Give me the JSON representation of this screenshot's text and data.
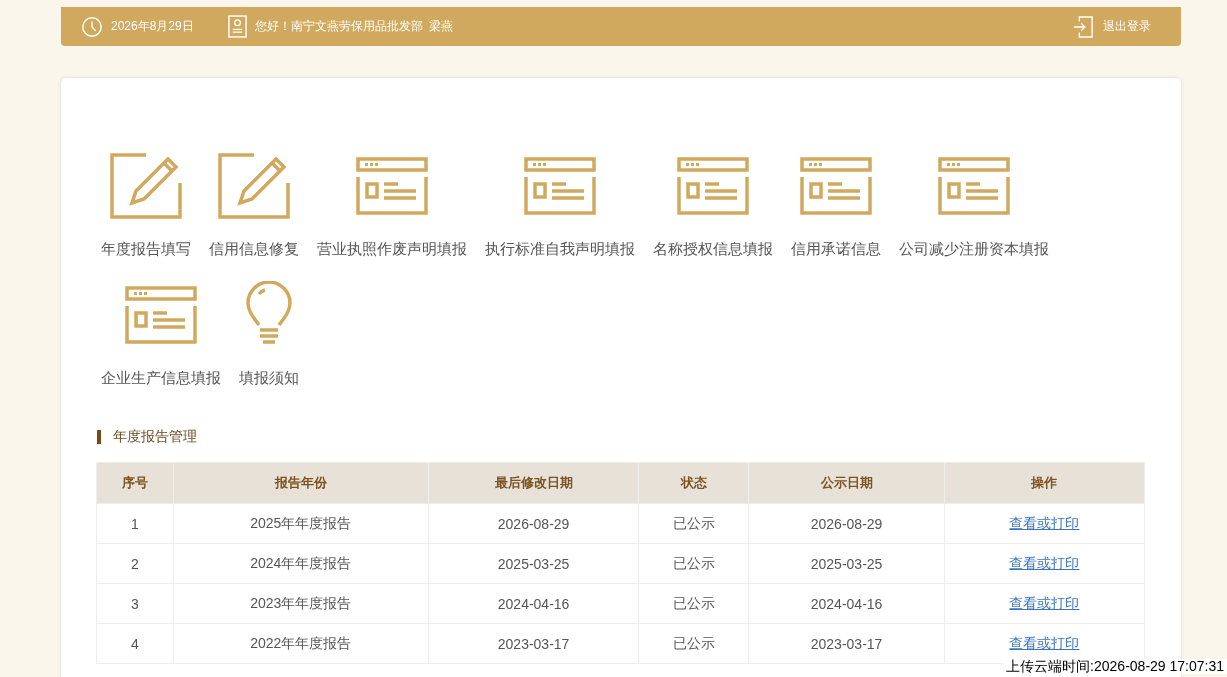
{
  "header": {
    "date": "2026年8月29日",
    "greeting": "您好！南宁文燕劳保用品批发部  梁燕",
    "logout": "退出登录"
  },
  "shortcuts": [
    {
      "kind": "edit",
      "label": "年度报告填写"
    },
    {
      "kind": "edit",
      "label": "信用信息修复"
    },
    {
      "kind": "form",
      "label": "营业执照作废声明填报"
    },
    {
      "kind": "form",
      "label": "执行标准自我声明填报"
    },
    {
      "kind": "form",
      "label": "名称授权信息填报"
    },
    {
      "kind": "form",
      "label": "信用承诺信息"
    },
    {
      "kind": "form",
      "label": "公司减少注册资本填报"
    },
    {
      "kind": "form",
      "label": "企业生产信息填报"
    },
    {
      "kind": "bulb",
      "label": "填报须知"
    }
  ],
  "section_title": "年度报告管理",
  "table": {
    "columns": [
      "序号",
      "报告年份",
      "最后修改日期",
      "状态",
      "公示日期",
      "操作"
    ],
    "rows": [
      [
        "1",
        "2025年年度报告",
        "2026-08-29",
        "已公示",
        "2026-08-29",
        "查看或打印"
      ],
      [
        "2",
        "2024年年度报告",
        "2025-03-25",
        "已公示",
        "2025-03-25",
        "查看或打印"
      ],
      [
        "3",
        "2023年年度报告",
        "2024-04-16",
        "已公示",
        "2024-04-16",
        "查看或打印"
      ],
      [
        "4",
        "2022年年度报告",
        "2023-03-17",
        "已公示",
        "2023-03-17",
        "查看或打印"
      ]
    ]
  },
  "timestamp_overlay": "上传云端时间:2026-08-29 17:07:31"
}
